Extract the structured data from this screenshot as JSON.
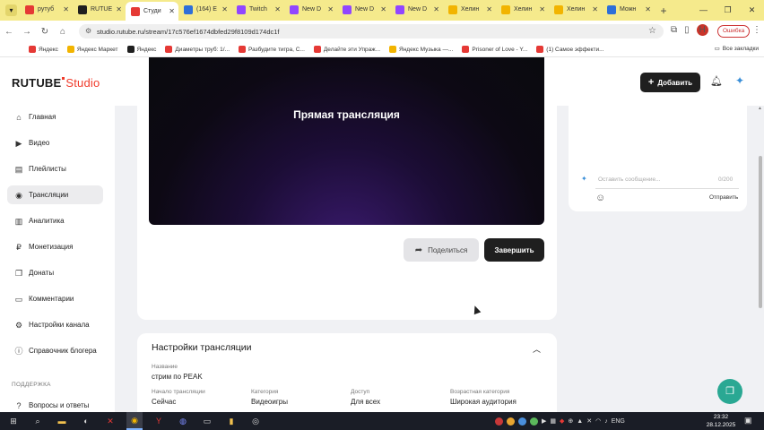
{
  "browser": {
    "tabs": [
      {
        "label": "рутуб",
        "color": "#e53935"
      },
      {
        "label": "RUTUE",
        "color": "#1f1f1f"
      },
      {
        "label": "Студи",
        "color": "#e53935",
        "active": true
      },
      {
        "label": "(164) E",
        "color": "#2e6fd8"
      },
      {
        "label": "Twitch",
        "color": "#9146ff"
      },
      {
        "label": "New D",
        "color": "#9146ff"
      },
      {
        "label": "New D",
        "color": "#9146ff"
      },
      {
        "label": "New D",
        "color": "#9146ff"
      },
      {
        "label": "Хелин",
        "color": "#f2b400"
      },
      {
        "label": "Хелин",
        "color": "#f2b400"
      },
      {
        "label": "Хелин",
        "color": "#f2b400"
      },
      {
        "label": "Можн",
        "color": "#2e6fd8"
      }
    ],
    "url": "studio.rutube.ru/stream/17c576ef1674dbfed29f8109d174dc1f",
    "profile_letter": "Н",
    "error_label": "Ошибка",
    "bookmarks": [
      {
        "label": "Яндекс",
        "color": "#e53935"
      },
      {
        "label": "Яндекс Маркет",
        "color": "#f2b400"
      },
      {
        "label": "Яндекс",
        "color": "#1f1f1f"
      },
      {
        "label": "Диаметры труб: 1/...",
        "color": "#e53935"
      },
      {
        "label": "Разбудите тигра, С...",
        "color": "#e53935"
      },
      {
        "label": "Делайте эти Упраж...",
        "color": "#e53935"
      },
      {
        "label": "Яндекс Музыка —...",
        "color": "#f2b400"
      },
      {
        "label": "Prisoner of Love - Y...",
        "color": "#e53935"
      },
      {
        "label": "(1) Самое эффекти...",
        "color": "#e53935"
      }
    ],
    "all_bookmarks": "Все закладки"
  },
  "header": {
    "logo_main": "RUTUBE",
    "logo_accent": "Studio",
    "add_label": "Добавить"
  },
  "sidebar": {
    "items": [
      {
        "label": "Главная",
        "icon": "⌂"
      },
      {
        "label": "Видео",
        "icon": "▶"
      },
      {
        "label": "Плейлисты",
        "icon": "▤"
      },
      {
        "label": "Трансляции",
        "icon": "◉",
        "active": true
      },
      {
        "label": "Аналитика",
        "icon": "▥"
      },
      {
        "label": "Монетизация",
        "icon": "₽"
      },
      {
        "label": "Донаты",
        "icon": "❐"
      },
      {
        "label": "Комментарии",
        "icon": "▭"
      },
      {
        "label": "Настройки канала",
        "icon": "⚙"
      },
      {
        "label": "Справочник блогера",
        "icon": "ⓘ"
      }
    ],
    "section_support": "ПОДДЕРЖКА",
    "support_item": {
      "label": "Вопросы и ответы",
      "icon": "?"
    }
  },
  "player": {
    "title": "Прямая трансляция"
  },
  "actions": {
    "share_label": "Поделиться",
    "finish_label": "Завершить"
  },
  "chat": {
    "placeholder": "Оставить сообщение...",
    "counter": "0/200",
    "send_label": "Отправить"
  },
  "settings": {
    "title": "Настройки трансляции",
    "name_label": "Название",
    "name_value": "стрим по PEAK",
    "fields": [
      {
        "label": "Начало трансляции",
        "value": "Сейчас"
      },
      {
        "label": "Категория",
        "value": "Видеоигры"
      },
      {
        "label": "Доступ",
        "value": "Для всех"
      },
      {
        "label": "Возрастная категория",
        "value": "Широкая аудитория"
      }
    ]
  },
  "taskbar": {
    "lang": "ENG",
    "time": "23:32",
    "date": "28.12.2025"
  }
}
